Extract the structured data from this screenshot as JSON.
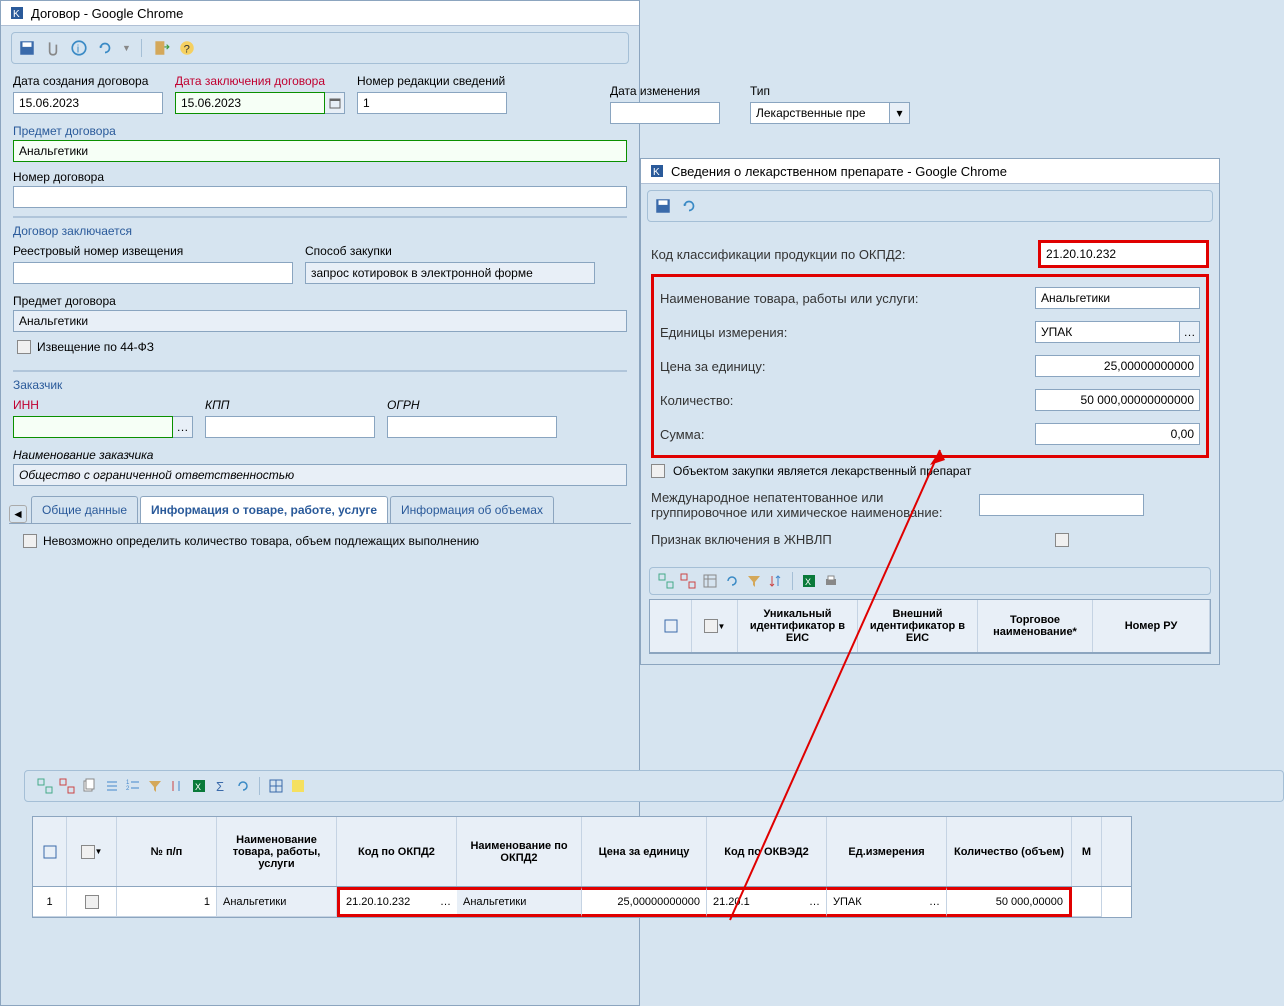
{
  "mainWindow": {
    "title": "Договор - Google Chrome",
    "fields": {
      "creationDateLabel": "Дата создания договора",
      "creationDate": "15.06.2023",
      "conclusionDateLabel": "Дата заключения договора",
      "conclusionDate": "15.06.2023",
      "revisionNumberLabel": "Номер редакции сведений",
      "revisionNumber": "1",
      "changeDateLabel": "Дата изменения",
      "changeDate": "",
      "typeLabel": "Тип",
      "type": "Лекарственные пре",
      "subjectLabel": "Предмет договора",
      "subject": "Анальгетики",
      "contractNumberLabel": "Номер договора",
      "contractNumber": "",
      "sectionContractConclusion": "Договор заключается",
      "registryNumberLabel": "Реестровый номер извещения",
      "registryNumber": "",
      "purchaseMethodLabel": "Способ закупки",
      "purchaseMethod": "запрос котировок в электронной форме",
      "subjectLabel2": "Предмет договора",
      "subject2": "Анальгетики",
      "notice44fz": "Извещение по 44-ФЗ",
      "customerSection": "Заказчик",
      "innLabel": "ИНН",
      "kppLabel": "КПП",
      "ogrnLabel": "ОГРН",
      "customerNameLabel": "Наименование заказчика",
      "customerName": "Общество с ограниченной ответственностью"
    },
    "tabs": {
      "t1": "Общие данные",
      "t2": "Информация о товаре, работе, услуге",
      "t3": "Информация об объемах"
    },
    "impossibleCheckbox": "Невозможно определить количество товара, объем подлежащих выполнению"
  },
  "dialog": {
    "title": "Сведения о лекарственном препарате - Google Chrome",
    "okpdLabel": "Код классификации продукции по ОКПД2:",
    "okpdValue": "21.20.10.232",
    "nameLabel": "Наименование товара, работы или услуги:",
    "nameValue": "Анальгетики",
    "unitLabel": "Единицы измерения:",
    "unitValue": "УПАК",
    "priceLabel": "Цена за единицу:",
    "priceValue": "25,00000000000",
    "qtyLabel": "Количество:",
    "qtyValue": "50 000,00000000000",
    "sumLabel": "Сумма:",
    "sumValue": "0,00",
    "isDrugCheckbox": "Объектом закупки является лекарственный препарат",
    "mnnLabel": "Международное непатентованное или группировочное или химическое наименование:",
    "zhnvlpLabel": "Признак включения в ЖНВЛП",
    "gridHeaders": {
      "h1": "Уникальный идентификатор в ЕИС",
      "h2": "Внешний идентификатор в ЕИС",
      "h3": "Торговое наименование*",
      "h4": "Номер РУ"
    }
  },
  "bottomGrid": {
    "headers": {
      "h0": "№ п/п",
      "h1": "Наименование товара, работы, услуги",
      "h2": "Код по ОКПД2",
      "h3": "Наименование по ОКПД2",
      "h4": "Цена за единицу",
      "h5": "Код по ОКВЭД2",
      "h6": "Ед.измерения",
      "h7": "Количество (объем)",
      "hM": "М"
    },
    "row": {
      "rownum": "1",
      "num": "1",
      "name": "Анальгетики",
      "okpd": "21.20.10.232",
      "okpdName": "Анальгетики",
      "price": "25,00000000000",
      "okved": "21.20.1",
      "unit": "УПАК",
      "qty": "50 000,00000"
    }
  }
}
